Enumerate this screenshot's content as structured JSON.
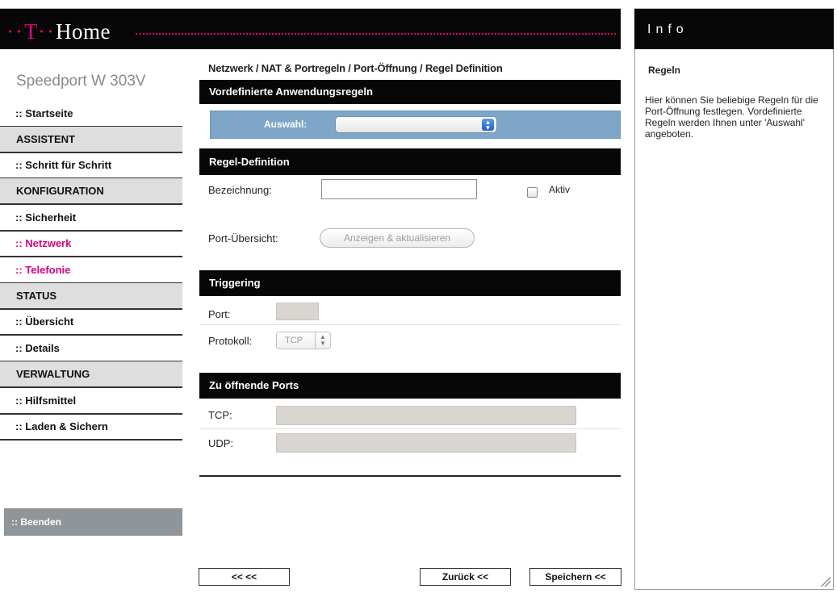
{
  "header": {
    "brand_dots": "··",
    "brand_t": "T",
    "brand_mid": "··",
    "brand_name": "Home",
    "info_title": "Info"
  },
  "sidebar": {
    "product_name": "Speedport W 303V",
    "items": [
      {
        "label": ":: Startseite"
      },
      {
        "label": "ASSISTENT"
      },
      {
        "label": ":: Schritt für Schritt"
      },
      {
        "label": "KONFIGURATION"
      },
      {
        "label": ":: Sicherheit"
      },
      {
        "label": ":: Netzwerk"
      },
      {
        "label": ":: Telefonie"
      },
      {
        "label": "STATUS"
      },
      {
        "label": ":: Übersicht"
      },
      {
        "label": ":: Details"
      },
      {
        "label": "VERWALTUNG"
      },
      {
        "label": ":: Hilfsmittel"
      },
      {
        "label": ":: Laden & Sichern"
      }
    ],
    "end_label": ":: Beenden"
  },
  "main": {
    "breadcrumb": "Netzwerk / NAT & Portregeln / Port-Öffnung / Regel Definition",
    "predefined": {
      "title": "Vordefinierte Anwendungsregeln",
      "select_label": "Auswahl:",
      "select_value": ""
    },
    "rule_definition": {
      "title": "Regel-Definition",
      "name_label": "Bezeichnung:",
      "name_value": "",
      "active_label": "Aktiv",
      "active_checked": false,
      "port_overview_label": "Port-Übersicht:",
      "port_overview_button": "Anzeigen & aktualisieren"
    },
    "triggering": {
      "title": "Triggering",
      "port_label": "Port:",
      "port_value": "",
      "protocol_label": "Protokoll:",
      "protocol_value": "TCP"
    },
    "open_ports": {
      "title": "Zu öffnende Ports",
      "tcp_label": "TCP:",
      "tcp_value": "",
      "udp_label": "UDP:",
      "udp_value": ""
    },
    "buttons": {
      "first": "<< <<",
      "back": "Zurück <<",
      "save": "Speichern <<"
    }
  },
  "info": {
    "heading": "Regeln",
    "text": "Hier können Sie beliebige Regeln für die Port-Öffnung festlegen. Vordefinierte Regeln werden Ihnen unter 'Auswahl' angeboten."
  },
  "colors": {
    "header_bg": "#070707",
    "brand_magenta": "#e2007a",
    "select_band": "#7ea6c9",
    "sidebar_head_bg": "#dedede",
    "end_button_bg": "#8f9599"
  }
}
